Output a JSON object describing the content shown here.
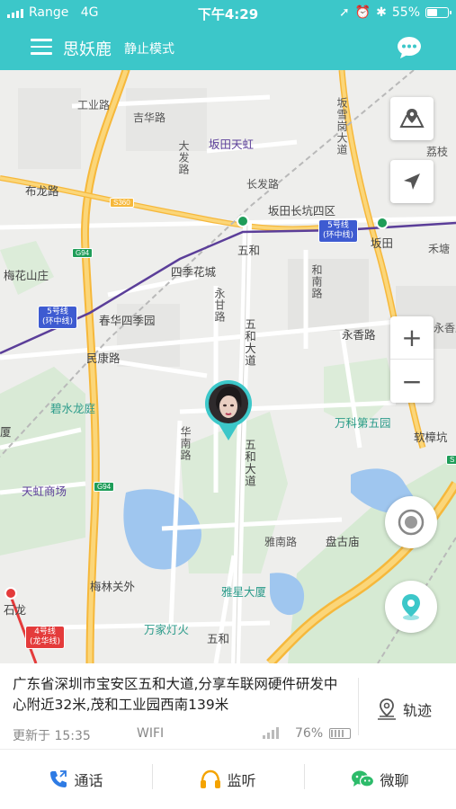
{
  "status_bar": {
    "carrier": "Range",
    "network": "4G",
    "time": "下午4:29",
    "battery_text": "55%",
    "battery_level": 0.55
  },
  "header": {
    "title": "思妖鹿",
    "mode": "静止模式"
  },
  "map": {
    "labels": {
      "gongye_road": "工业路",
      "jiye_road": "吉华路",
      "bantian_tianhong": "坂田天虹",
      "bantian_dadao": "坂雪岗大道",
      "lizhi": "荔枝",
      "bulong_road": "布龙路",
      "changfa_road": "长发路",
      "bantian_changkeng": "坂田长坑四区",
      "wuhe": "五和",
      "bantian": "坂田",
      "hetang": "禾塘",
      "meihua": "梅花山庄",
      "siji_huacheng": "四季花城",
      "yonggan_road": "永甘路",
      "hexiang_road": "和南路",
      "chunhua_siji": "春华四季园",
      "minkang_road": "民康路",
      "wuhe_dadao_1": "五和大道",
      "yongxiang_road": "永香路",
      "yongxiang_east": "永香路",
      "bishui": "碧水龙庭",
      "huanan_road": "华南路",
      "wanke": "万科第五园",
      "ruanji": "软樟坑",
      "wuhe_dadao_2": "五和大道",
      "tianhong_mall": "天虹商场",
      "yanan_road": "雅南路",
      "pangu": "盘古庙",
      "meilin": "梅林关外",
      "yaxing": "雅星大厦",
      "shilong": "石龙",
      "wanjia": "万家灯火",
      "wuhe_bottom": "五和",
      "dadao_left": "大发路",
      "sha": "厦"
    },
    "badges": {
      "line5_a": "5号线",
      "line5_a2": "(环中线)",
      "line5_b": "5号线",
      "line5_b2": "(环中线)",
      "line4": "4号线",
      "line4b": "(龙华线)",
      "s360": "S360",
      "g94_a": "G94",
      "g94_b": "G94",
      "s5": "S"
    },
    "zoom_in": "+",
    "zoom_out": "−"
  },
  "address": {
    "text": "广东省深圳市宝安区五和大道,分享车联网硬件研发中心附近32米,茂和工业园西南139米",
    "updated": "更新于 15:35",
    "network": "WIFI",
    "battery": "76%",
    "battery_level": 0.76,
    "track_label": "轨迹"
  },
  "toolbar": {
    "call": "通话",
    "listen": "监听",
    "wechat": "微聊"
  },
  "colors": {
    "accent": "#3cc7c9",
    "metro_line": "#5b3e99",
    "road_major": "#f6b83b"
  }
}
